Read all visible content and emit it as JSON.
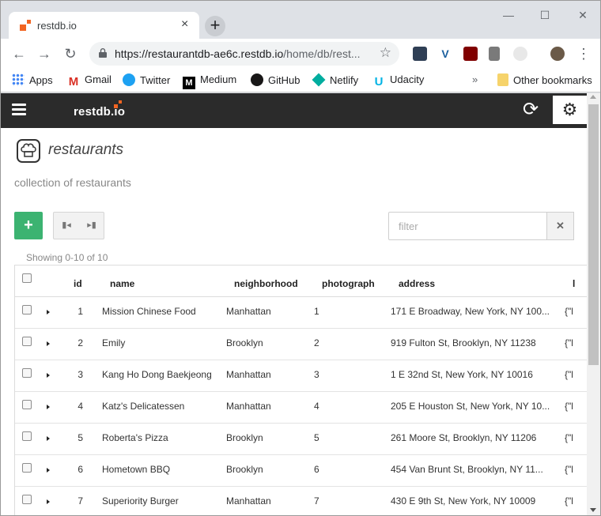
{
  "browser": {
    "tab_title": "restdb.io",
    "tab_close": "×",
    "new_tab": "+",
    "url_host": "https://restaurantdb-ae6c.restdb.io",
    "url_path": "/home/db/rest...",
    "window_controls": {
      "minimize": "—",
      "maximize": "☐",
      "close": "✕"
    }
  },
  "bookmarks": {
    "items": [
      {
        "label": "Apps",
        "icon": "apps-grid-icon",
        "color": "#4285f4"
      },
      {
        "label": "Gmail",
        "icon": "gmail-icon",
        "color": "#d93025"
      },
      {
        "label": "Twitter",
        "icon": "twitter-icon",
        "color": "#1da1f2"
      },
      {
        "label": "Medium",
        "icon": "medium-icon",
        "color": "#000000"
      },
      {
        "label": "GitHub",
        "icon": "github-icon",
        "color": "#181717"
      },
      {
        "label": "Netlify",
        "icon": "netlify-icon",
        "color": "#00ad9f"
      },
      {
        "label": "Udacity",
        "icon": "udacity-icon",
        "color": "#02b3e4"
      }
    ],
    "more": "»",
    "other": "Other bookmarks"
  },
  "app": {
    "brand": "restdb.io",
    "collection_title": "restaurants",
    "collection_description": "collection of restaurants",
    "add_label": "+",
    "filter_placeholder": "filter",
    "clear_label": "✕",
    "showing": "Showing 0-10 of 10"
  },
  "table": {
    "columns": [
      "id",
      "name",
      "neighborhood",
      "photograph",
      "address",
      "l"
    ],
    "rows": [
      {
        "id": "1",
        "name": "Mission Chinese Food",
        "neighborhood": "Manhattan",
        "photograph": "1",
        "address": "171 E Broadway, New York, NY 100...",
        "extra": "{\"l"
      },
      {
        "id": "2",
        "name": "Emily",
        "neighborhood": "Brooklyn",
        "photograph": "2",
        "address": "919 Fulton St, Brooklyn, NY 11238",
        "extra": "{\"l"
      },
      {
        "id": "3",
        "name": "Kang Ho Dong Baekjeong",
        "neighborhood": "Manhattan",
        "photograph": "3",
        "address": "1 E 32nd St, New York, NY 10016",
        "extra": "{\"l"
      },
      {
        "id": "4",
        "name": "Katz's Delicatessen",
        "neighborhood": "Manhattan",
        "photograph": "4",
        "address": "205 E Houston St, New York, NY 10...",
        "extra": "{\"l"
      },
      {
        "id": "5",
        "name": "Roberta's Pizza",
        "neighborhood": "Brooklyn",
        "photograph": "5",
        "address": "261 Moore St, Brooklyn, NY 11206",
        "extra": "{\"l"
      },
      {
        "id": "6",
        "name": "Hometown BBQ",
        "neighborhood": "Brooklyn",
        "photograph": "6",
        "address": "454 Van Brunt St, Brooklyn, NY 11...",
        "extra": "{\"l"
      },
      {
        "id": "7",
        "name": "Superiority Burger",
        "neighborhood": "Manhattan",
        "photograph": "7",
        "address": "430 E 9th St, New York, NY 10009",
        "extra": "{\"l"
      }
    ]
  },
  "colors": {
    "appbar": "#2b2b2b",
    "add_button": "#3cb371",
    "brand_accent": "#f26522"
  }
}
